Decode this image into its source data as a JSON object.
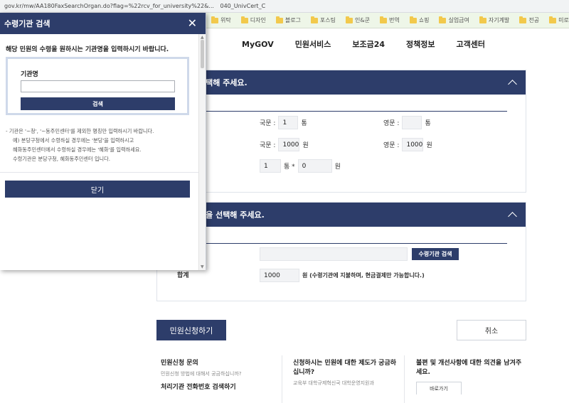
{
  "browser": {
    "url": "gov.kr/mw/AA180FaxSearchOrgan.do?flag=%22rcv_for_university%22&...",
    "tab_suffix": "040_UnivCert_C",
    "bookmarks": [
      "위탁",
      "디자인",
      "블로그",
      "포스팅",
      "인&쿤",
      "번역",
      "쇼핑",
      "실업급여",
      "자기계발",
      "전공",
      "미로"
    ]
  },
  "site_nav": [
    "MyGOV",
    "민원서비스",
    "보조금24",
    "정책정보",
    "고객센터"
  ],
  "panel1": {
    "title": "선택해 주세요.",
    "korean_label": "국문 :",
    "korean_count": "1",
    "count_unit": "통",
    "english_label": "영문 :",
    "english_count": "",
    "korean_fee_label": "국문 :",
    "korean_fee": "1000",
    "fee_unit": "원",
    "english_fee_label": "영문 :",
    "english_fee": "1000",
    "calc_count": "1",
    "calc_op": "통 *",
    "calc_fee": "0",
    "calc_unit": "원"
  },
  "panel2": {
    "title": "관을 선택해 주세요.",
    "search_button": "수령기관 검색",
    "total_label": "합계",
    "total_value": "1000",
    "total_note": "원 (수령기관에 지불하며, 현금결제만 가능합니다.)"
  },
  "actions": {
    "apply": "민원신청하기",
    "cancel": "취소"
  },
  "footer": {
    "col1_title": "민원신청 문의",
    "col1_sub": "민원신청 방법에 대해서 궁금하십니까?",
    "col1_link": "처리기관 전화번호 검색하기",
    "col2_title": "신청하시는 민원에 대한 제도가 궁금하십니까?",
    "col2_sub": "교육부 대학규제혁신국 대학운영지원과",
    "col3_title": "불편 및 개선사항에 대한 의견을 남겨주세요.",
    "col3_button": "바로가기"
  },
  "modal": {
    "title": "수령기관 검색",
    "close_symbol": "✕",
    "intro": "해당 민원의 수령을 원하시는 기관명을 입력하시기 바랍니다.",
    "field_label": "기관명",
    "field_value": "",
    "search_button": "검색",
    "guide": [
      "- 기관은 '~청', '~동주민센터'를 제외한 명칭만 입력하시기 바랍니다.",
      "예) 분당구청에서 수령하실 경우에는 '분당'을 입력하시고",
      "혜화동주민센터에서 수령하실 경우에는 '혜화'를 입력하세요.",
      "수령기관은 분당구청, 혜화동주민센터 입니다."
    ],
    "close_button": "닫기"
  },
  "colors": {
    "primary": "#2d3d6a",
    "accent_border": "#cfd9ea",
    "bookmark_bar": "#eef6e8"
  }
}
